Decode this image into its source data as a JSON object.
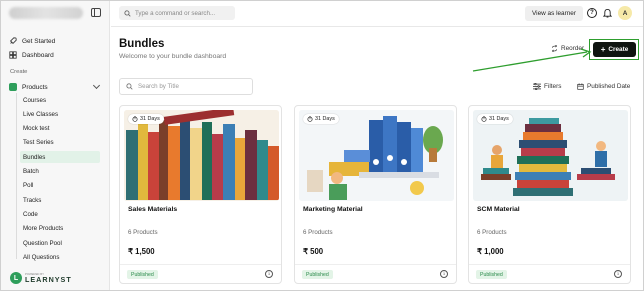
{
  "sidebar": {
    "nav": [
      {
        "label": "Get Started",
        "icon": "rocket-icon"
      },
      {
        "label": "Dashboard",
        "icon": "grid-icon"
      }
    ],
    "section_label": "Create",
    "products_label": "Products",
    "sub_items": [
      {
        "label": "Courses"
      },
      {
        "label": "Live Classes"
      },
      {
        "label": "Mock test"
      },
      {
        "label": "Test Series"
      },
      {
        "label": "Bundles",
        "active": true
      },
      {
        "label": "Batch"
      },
      {
        "label": "Poll"
      },
      {
        "label": "Tracks"
      },
      {
        "label": "Code"
      },
      {
        "label": "More Products"
      },
      {
        "label": "Question Pool"
      },
      {
        "label": "All Questions"
      }
    ],
    "footer": {
      "powered_by": "POWERED BY",
      "brand": "LEARNYST"
    }
  },
  "topbar": {
    "search_placeholder": "Type a command or search...",
    "view_as_learner": "View as learner",
    "avatar_initial": "A"
  },
  "main": {
    "title": "Bundles",
    "subtitle": "Welcome to your bundle dashboard",
    "reorder_label": "Reorder",
    "create_label": "Create",
    "search_placeholder": "Search by Title",
    "filters_label": "Filters",
    "sort_label": "Published Date"
  },
  "cards": [
    {
      "days": "31 Days",
      "title": "Sales Materials",
      "products": "6 Products",
      "price": "₹ 1,500",
      "status": "Published",
      "image": "stacked-books-illustration"
    },
    {
      "days": "31 Days",
      "title": "Marketing Material",
      "products": "6 Products",
      "price": "₹ 500",
      "status": "Published",
      "image": "binders-and-student-illustration"
    },
    {
      "days": "31 Days",
      "title": "SCM Material",
      "products": "6 Products",
      "price": "₹ 1,000",
      "status": "Published",
      "image": "book-tower-and-people-illustration"
    }
  ],
  "colors": {
    "accent_green": "#2e9e5b",
    "create_button_bg": "#0f1410",
    "annotation_green": "#2e9e2e",
    "published_badge_bg": "#e3f4e7",
    "published_badge_text": "#2a8a4a",
    "active_nav_bg": "#e2f2e8"
  }
}
